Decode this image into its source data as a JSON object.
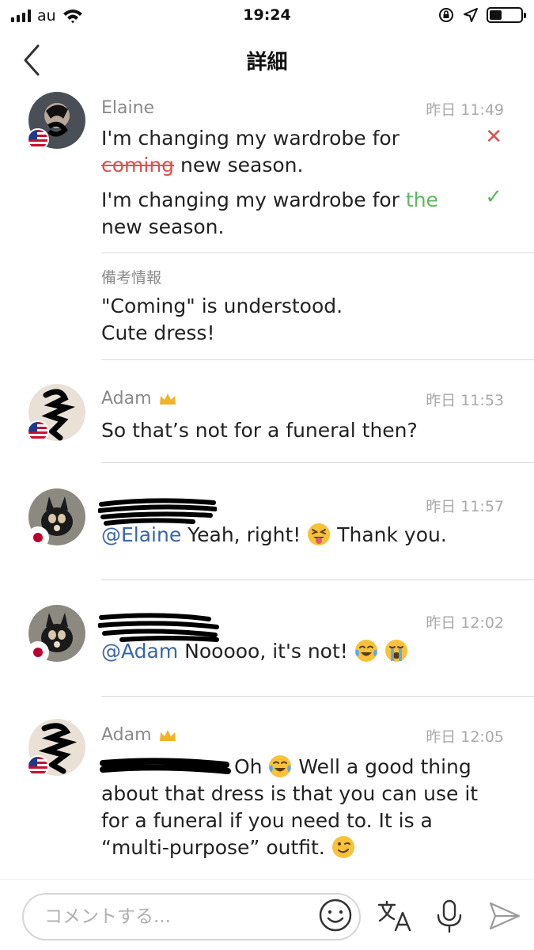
{
  "status_bar": {
    "carrier": "au",
    "time": "19:24"
  },
  "nav": {
    "title": "詳細"
  },
  "entries": [
    {
      "name": "Elaine",
      "time": "昨日 11:49",
      "original": {
        "before": " I'm changing my wardrobe for",
        "struck": "coming",
        "after": " new season."
      },
      "corrected": {
        "before": " I'm changing my wardrobe for ",
        "added": "the",
        "after": "new season."
      },
      "memo_label": "備考情報",
      "memo_line1": "\"Coming\" is understood.",
      "memo_line2": "Cute dress!"
    },
    {
      "name": "Adam",
      "time": "昨日 11:53",
      "text": "So that’s not for a funeral then?"
    },
    {
      "time": "昨日 11:57",
      "mention": "@Elaine",
      "text_before": " Yeah, right! ",
      "text_after": " Thank you."
    },
    {
      "time": "昨日 12:02",
      "mention": "@Adam",
      "text_before": " Nooooo, it's not! "
    },
    {
      "name": "Adam",
      "time": "昨日 12:05",
      "line1_after": " Oh ",
      "line1_end": " Well a good thing",
      "line2": "about that dress is that you can use it",
      "line3": "for a funeral if you need to. It is a",
      "line4": "“multi-purpose” outfit. "
    }
  ],
  "comment_bar": {
    "placeholder": "コメントする..."
  },
  "colors": {
    "mention": "#3a66a7",
    "strike": "#d9534f",
    "accept": "#5cb85c",
    "crown": "#f0b429"
  }
}
